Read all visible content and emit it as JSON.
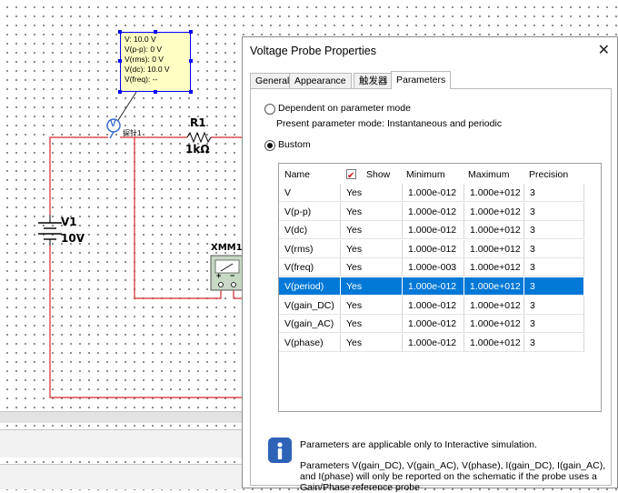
{
  "schematic": {
    "probe_readout": [
      "V: 10.0 V",
      "V(p-p): 0 V",
      "V(rms): 0 V",
      "V(dc): 10.0 V",
      "V(freq): --"
    ],
    "probe_marker": "V",
    "probe_name": "探针1",
    "resistor_ref": "R1",
    "resistor_value": "1kΩ",
    "source_ref": "V1",
    "source_value": "10V",
    "meter_ref": "XMM1",
    "meter_plus": "+",
    "meter_minus": "−",
    "wire_color": "#d62828"
  },
  "dialog": {
    "title": "Voltage Probe Properties",
    "tabs": [
      "General",
      "Appearance",
      "触发器",
      "Parameters"
    ],
    "active_tab": "Parameters",
    "radio_dependent_label": "Dependent on parameter mode",
    "present_mode_text": "Present parameter mode:  Instantaneous and periodic",
    "radio_custom_label": "Bustom",
    "selected_radio": "Bustom",
    "columns": [
      "Name",
      "Show",
      "Minimum",
      "Maximum",
      "Precision"
    ],
    "rows": [
      {
        "name": "V",
        "show": "Yes",
        "min": "1.000e-012",
        "max": "1.000e+012",
        "precision": "3"
      },
      {
        "name": "V(p-p)",
        "show": "Yes",
        "min": "1.000e-012",
        "max": "1.000e+012",
        "precision": "3"
      },
      {
        "name": "V(dc)",
        "show": "Yes",
        "min": "1.000e-012",
        "max": "1.000e+012",
        "precision": "3"
      },
      {
        "name": "V(rms)",
        "show": "Yes",
        "min": "1.000e-012",
        "max": "1.000e+012",
        "precision": "3"
      },
      {
        "name": "V(freq)",
        "show": "Yes",
        "min": "1.000e-003",
        "max": "1.000e+012",
        "precision": "3"
      },
      {
        "name": "V(period)",
        "show": "Yes",
        "min": "1.000e-012",
        "max": "1.000e+012",
        "precision": "3"
      },
      {
        "name": "V(gain_DC)",
        "show": "Yes",
        "min": "1.000e-012",
        "max": "1.000e+012",
        "precision": "3"
      },
      {
        "name": "V(gain_AC)",
        "show": "Yes",
        "min": "1.000e-012",
        "max": "1.000e+012",
        "precision": "3"
      },
      {
        "name": "V(phase)",
        "show": "Yes",
        "min": "1.000e-012",
        "max": "1.000e+012",
        "precision": "3"
      }
    ],
    "selected_row": "V(period)",
    "selection_color": "#0078d7",
    "info_line1": "Parameters are applicable only to Interactive simulation.",
    "info_line2": "Parameters V(gain_DC), V(gain_AC), V(phase), I(gain_DC), I(gain_AC),",
    "info_line3": "and I(phase) will only be reported on the schematic if the probe uses a",
    "info_line4": "Gain/Phase reference probe",
    "info_icon": "info-icon"
  }
}
